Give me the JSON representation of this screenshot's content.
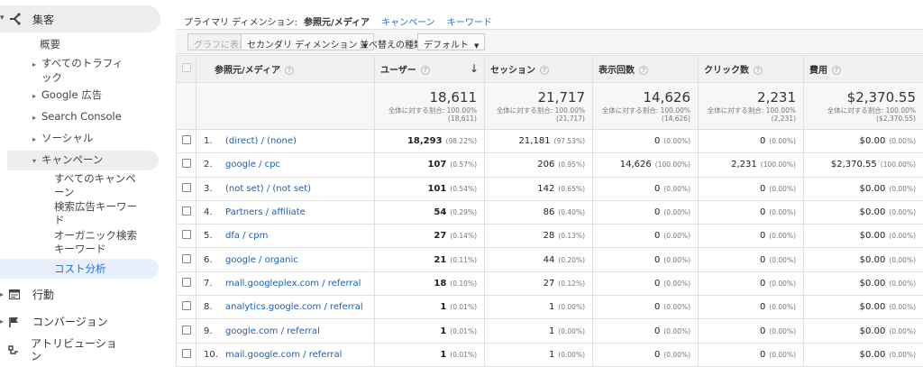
{
  "sidebar": {
    "acquisition": "集客",
    "items": [
      {
        "label": "概要"
      },
      {
        "label": "すべてのトラフィ"
      },
      {
        "label": "ック"
      },
      {
        "label": "Google 広告"
      },
      {
        "label": "Search Console"
      },
      {
        "label": "ソーシャル"
      },
      {
        "label": "キャンペーン"
      },
      {
        "label": "すべてのキャンペ"
      },
      {
        "label": "ーン"
      },
      {
        "label": "検索広告キーワー"
      },
      {
        "label": "ド"
      },
      {
        "label": "オーガニック検索"
      },
      {
        "label": "キーワード"
      },
      {
        "label": "コスト分析"
      }
    ],
    "behavior": "行動",
    "conversions": "コンバージョン",
    "attribution1": "アトリビューショ",
    "attribution2": "ン"
  },
  "dimension_bar": {
    "label": "プライマリ ディメンション:",
    "current": "参照元/メディア",
    "link1": "キャンペーン",
    "link2": "キーワード"
  },
  "toolbar": {
    "graph_button": "グラフに表示",
    "secondary_dim": "セカンダリ ディメンション",
    "sort_label": "並べ替えの種類:",
    "sort_value": "デフォルト"
  },
  "table": {
    "headers": [
      "参照元/メディア",
      "ユーザー",
      "セッション",
      "表示回数",
      "クリック数",
      "費用"
    ],
    "totals": [
      {
        "value": "18,611",
        "pct_label": "全体に対する割合: 100.00%",
        "base": "(18,611)"
      },
      {
        "value": "21,717",
        "pct_label": "全体に対する割合: 100.00%",
        "base": "(21,717)"
      },
      {
        "value": "14,626",
        "pct_label": "全体に対する割合: 100.00%",
        "base": "(14,626)"
      },
      {
        "value": "2,231",
        "pct_label": "全体に対する割合: 100.00%",
        "base": "(2,231)"
      },
      {
        "value": "$2,370.55",
        "pct_label": "全体に対する割合: 100.00%",
        "base": "($2,370.55)"
      }
    ],
    "rows": [
      {
        "idx": "1.",
        "source": "(direct) / (none)",
        "users": "18,293",
        "users_pct": "(98.22%)",
        "sessions": "21,181",
        "sessions_pct": "(97.53%)",
        "impr": "0",
        "impr_pct": "(0.00%)",
        "clicks": "0",
        "clicks_pct": "(0.00%)",
        "cost": "$0.00",
        "cost_pct": "(0.00%)"
      },
      {
        "idx": "2.",
        "source": "google / cpc",
        "users": "107",
        "users_pct": "(0.57%)",
        "sessions": "206",
        "sessions_pct": "(0.95%)",
        "impr": "14,626",
        "impr_pct": "(100.00%)",
        "clicks": "2,231",
        "clicks_pct": "(100.00%)",
        "cost": "$2,370.55",
        "cost_pct": "(100.00%)"
      },
      {
        "idx": "3.",
        "source": "(not set) / (not set)",
        "users": "101",
        "users_pct": "(0.54%)",
        "sessions": "142",
        "sessions_pct": "(0.65%)",
        "impr": "0",
        "impr_pct": "(0.00%)",
        "clicks": "0",
        "clicks_pct": "(0.00%)",
        "cost": "$0.00",
        "cost_pct": "(0.00%)"
      },
      {
        "idx": "4.",
        "source": "Partners / affiliate",
        "users": "54",
        "users_pct": "(0.29%)",
        "sessions": "86",
        "sessions_pct": "(0.40%)",
        "impr": "0",
        "impr_pct": "(0.00%)",
        "clicks": "0",
        "clicks_pct": "(0.00%)",
        "cost": "$0.00",
        "cost_pct": "(0.00%)"
      },
      {
        "idx": "5.",
        "source": "dfa / cpm",
        "users": "27",
        "users_pct": "(0.14%)",
        "sessions": "28",
        "sessions_pct": "(0.13%)",
        "impr": "0",
        "impr_pct": "(0.00%)",
        "clicks": "0",
        "clicks_pct": "(0.00%)",
        "cost": "$0.00",
        "cost_pct": "(0.00%)"
      },
      {
        "idx": "6.",
        "source": "google / organic",
        "users": "21",
        "users_pct": "(0.11%)",
        "sessions": "44",
        "sessions_pct": "(0.20%)",
        "impr": "0",
        "impr_pct": "(0.00%)",
        "clicks": "0",
        "clicks_pct": "(0.00%)",
        "cost": "$0.00",
        "cost_pct": "(0.00%)"
      },
      {
        "idx": "7.",
        "source": "mall.googleplex.com / referral",
        "users": "18",
        "users_pct": "(0.10%)",
        "sessions": "27",
        "sessions_pct": "(0.12%)",
        "impr": "0",
        "impr_pct": "(0.00%)",
        "clicks": "0",
        "clicks_pct": "(0.00%)",
        "cost": "$0.00",
        "cost_pct": "(0.00%)"
      },
      {
        "idx": "8.",
        "source": "analytics.google.com / referral",
        "users": "1",
        "users_pct": "(0.01%)",
        "sessions": "1",
        "sessions_pct": "(0.00%)",
        "impr": "0",
        "impr_pct": "(0.00%)",
        "clicks": "0",
        "clicks_pct": "(0.00%)",
        "cost": "$0.00",
        "cost_pct": "(0.00%)"
      },
      {
        "idx": "9.",
        "source": "google.com / referral",
        "users": "1",
        "users_pct": "(0.01%)",
        "sessions": "1",
        "sessions_pct": "(0.00%)",
        "impr": "0",
        "impr_pct": "(0.00%)",
        "clicks": "0",
        "clicks_pct": "(0.00%)",
        "cost": "$0.00",
        "cost_pct": "(0.00%)"
      },
      {
        "idx": "10.",
        "source": "mail.google.com / referral",
        "users": "1",
        "users_pct": "(0.01%)",
        "sessions": "1",
        "sessions_pct": "(0.00%)",
        "impr": "0",
        "impr_pct": "(0.00%)",
        "clicks": "0",
        "clicks_pct": "(0.00%)",
        "cost": "$0.00",
        "cost_pct": "(0.00%)"
      }
    ]
  },
  "colors": {
    "link": "#1a5fb4",
    "accent": "#1a73e8",
    "selected_bg": "#e8f0fe"
  }
}
